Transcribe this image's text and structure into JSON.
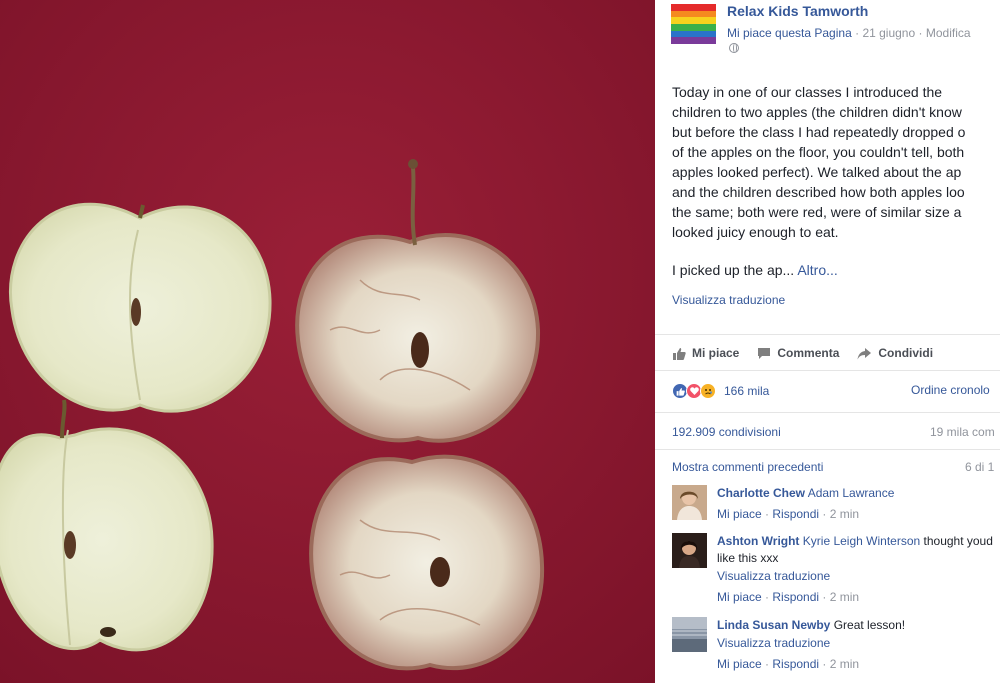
{
  "page": {
    "name": "Relax Kids Tamworth",
    "like_page": "Mi piace questa Pagina",
    "date": "21 giugno",
    "edit": "Modifica",
    "separator": "·"
  },
  "post": {
    "lines": [
      "Today in one of our classes I introduced the",
      "children to two apples (the children didn't know",
      "but before the class I had repeatedly dropped o",
      "of the apples on the floor, you couldn't tell, both",
      "apples looked perfect). We talked about the ap",
      "and the children described how both apples loo",
      "the same; both were red, were of similar size a",
      "looked juicy enough to eat."
    ],
    "truncated_text": "I picked up the ap...",
    "more_link": "Altro...",
    "translate": "Visualizza traduzione"
  },
  "actions": {
    "like": "Mi piace",
    "comment": "Commenta",
    "share": "Condividi"
  },
  "stats": {
    "reactions": "166 mila",
    "order": "Ordine cronolo",
    "shares": "192.909 condivisioni",
    "comments": "19 mila com",
    "previous_comments": "Mostra commenti precedenti",
    "page_count": "6 di 1"
  },
  "comments": [
    {
      "author": "Charlotte Chew",
      "mention": "Adam Lawrance",
      "text": "",
      "like": "Mi piace",
      "reply": "Rispondi",
      "time": "2 min"
    },
    {
      "author": "Ashton Wright",
      "mention": "Kyrie Leigh Winterson",
      "text": "thought youd like this xxx",
      "translate": "Visualizza traduzione",
      "like": "Mi piace",
      "reply": "Rispondi",
      "time": "2 min"
    },
    {
      "author": "Linda Susan Newby",
      "mention": "",
      "text": "Great lesson!",
      "translate": "Visualizza traduzione",
      "like": "Mi piace",
      "reply": "Rispondi",
      "time": "2 min"
    }
  ],
  "colors": {
    "link": "#365899",
    "photo_background": "#8e1a30",
    "text": "#1d2129",
    "meta": "#90949c"
  },
  "icons": [
    "thumbs-up-icon",
    "comment-icon",
    "share-icon",
    "like-reaction-icon",
    "love-reaction-icon",
    "sad-reaction-icon",
    "globe-icon"
  ]
}
